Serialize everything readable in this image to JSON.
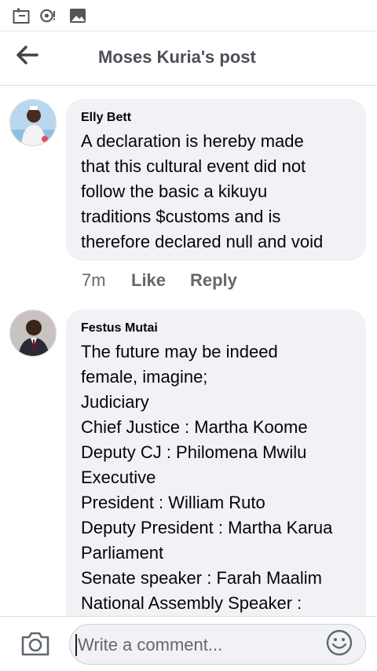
{
  "status_bar": {
    "icons": [
      "calendar-icon",
      "cast-notification-icon",
      "gallery-icon"
    ]
  },
  "header": {
    "title": "Moses Kuria's post",
    "back_icon": "back-arrow-icon"
  },
  "comments": [
    {
      "author": "Elly Bett",
      "lines": [
        "A declaration is hereby made",
        "that this cultural event did not",
        "follow the basic a kikuyu",
        "traditions $customs and is",
        "therefore declared null and void"
      ],
      "time": "7m",
      "like_label": "Like",
      "reply_label": "Reply"
    },
    {
      "author": "Festus Mutai",
      "lines": [
        "The future may be indeed",
        "female, imagine;",
        "Judiciary",
        "Chief Justice : Martha Koome",
        "Deputy CJ : Philomena Mwilu",
        "Executive",
        "President : William Ruto",
        "Deputy President : Martha Karua",
        "Parliament",
        "Senate speaker : Farah Maalim",
        "National Assembly Speaker :"
      ]
    }
  ],
  "composer": {
    "placeholder": "Write a comment...",
    "camera_icon": "camera-icon",
    "emoji_icon": "emoji-icon"
  },
  "colors": {
    "bubble": "#f0f2f5",
    "secondary_text": "#65676b",
    "title_text": "#4b4f56"
  }
}
